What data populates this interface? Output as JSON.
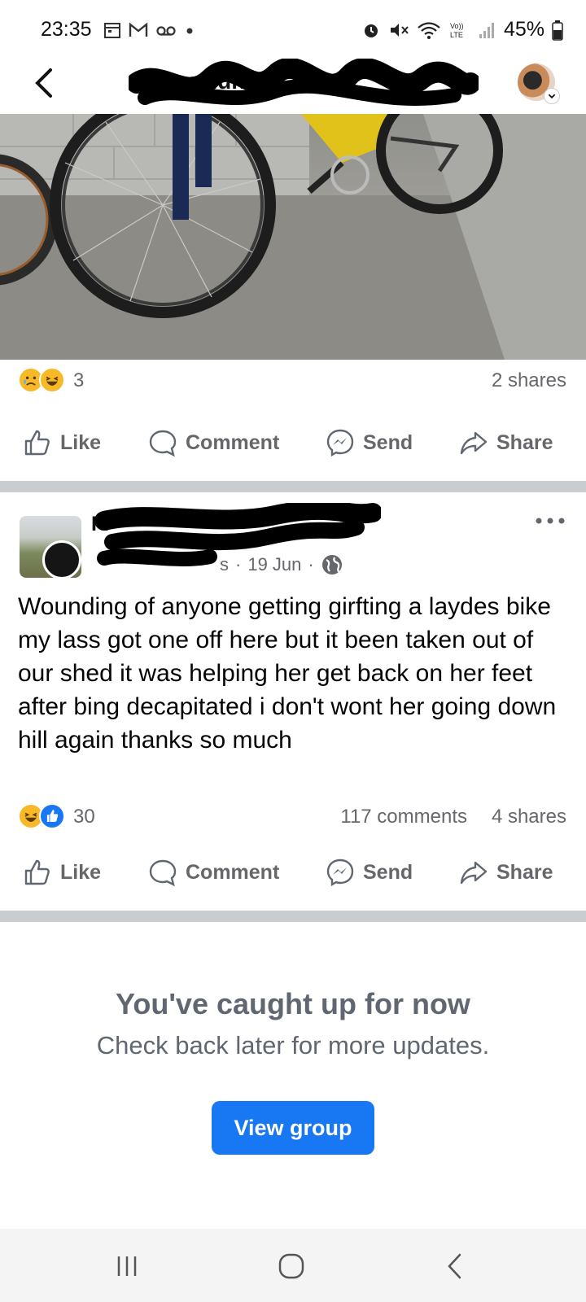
{
  "status_bar": {
    "time": "23:35",
    "battery": "45%",
    "left_icons": [
      "calendar-icon",
      "gmail-icon",
      "voicemail-icon",
      "dot-icon"
    ],
    "right_icons": [
      "alarm-icon",
      "mute-icon",
      "wifi-icon",
      "volte-icon",
      "signal-icon",
      "battery-icon"
    ]
  },
  "header": {
    "group_title": "Community"
  },
  "post1": {
    "reaction_count": "3",
    "reactions": [
      "sad",
      "haha"
    ],
    "shares": "2 shares"
  },
  "actions": {
    "like": "Like",
    "comment": "Comment",
    "send": "Send",
    "share": "Share"
  },
  "post2": {
    "author": "Fl",
    "meta_suffix": "s",
    "date": "19 Jun",
    "separator": "·",
    "text": "Wounding of anyone getting girfting a laydes bike my lass got one off here but it been taken out of our shed it was helping her get back on her feet after bing decapitated i don't wont her going down hill again thanks so much",
    "reaction_count": "30",
    "reactions": [
      "haha",
      "like"
    ],
    "comments": "117 comments",
    "shares": "4 shares"
  },
  "caught_up": {
    "title": "You've caught up for now",
    "subtitle": "Check back later for more updates.",
    "button": "View group"
  },
  "colors": {
    "accent": "#1877f2",
    "secondary_text": "#65676b",
    "divider": "#c9ccd1"
  }
}
